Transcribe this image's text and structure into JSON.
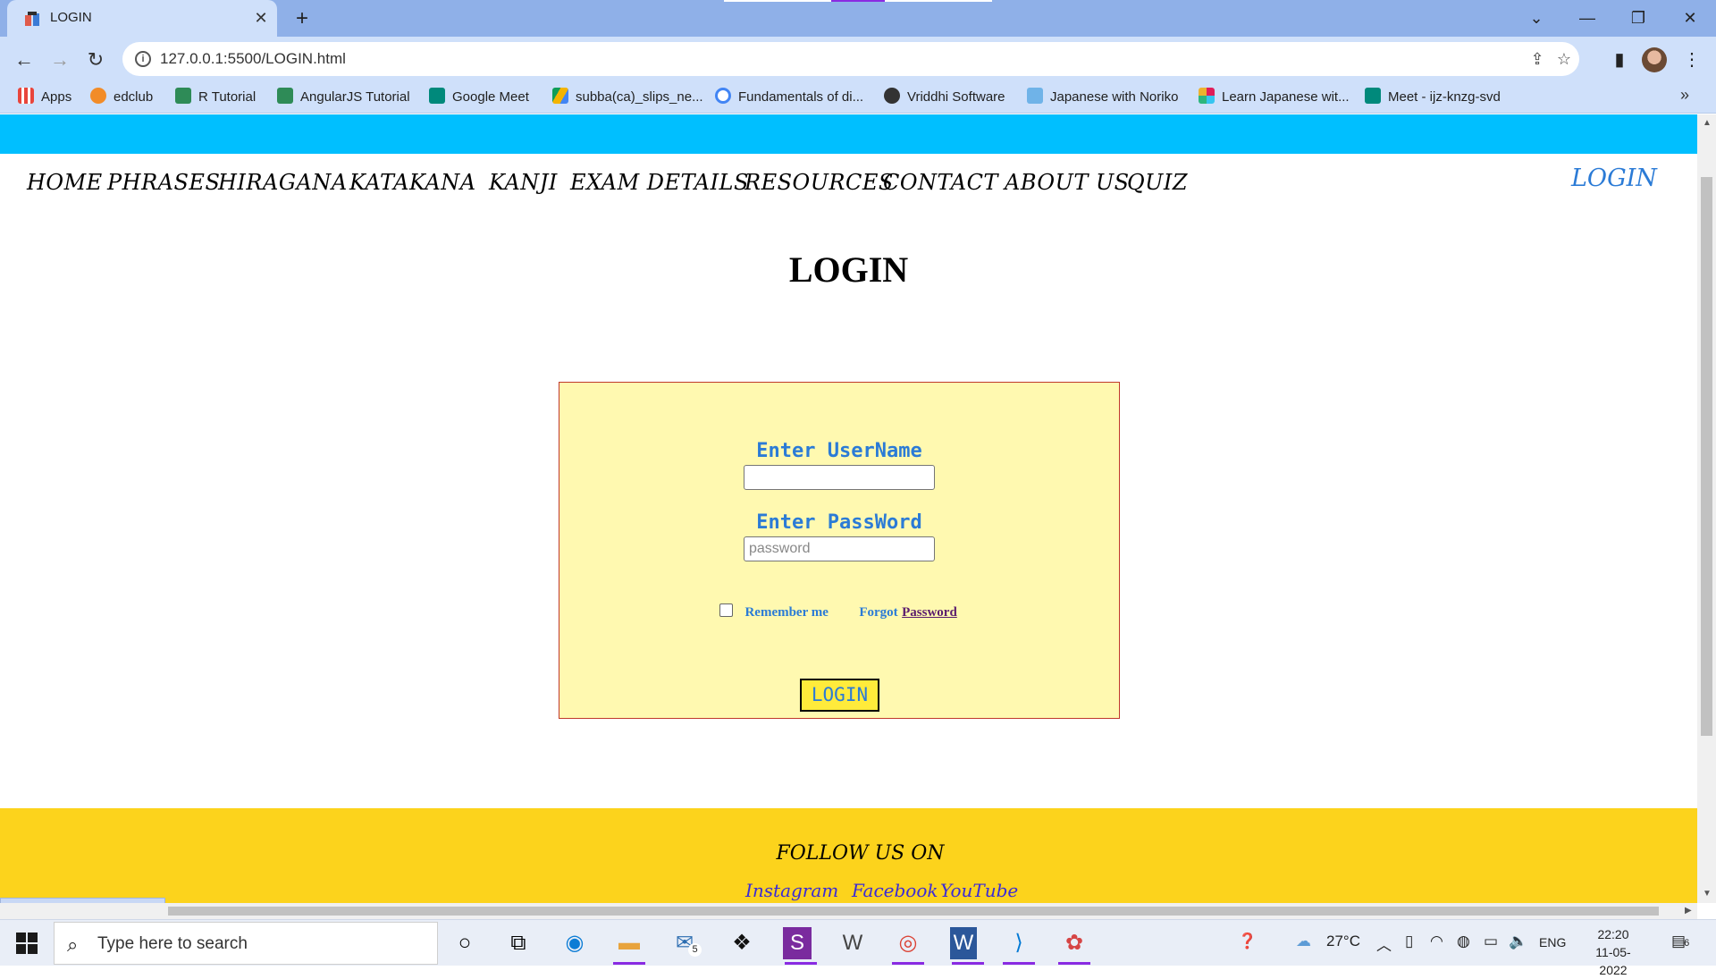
{
  "browser": {
    "tab_title": "LOGIN",
    "new_tab_symbol": "+",
    "close_symbol": "✕",
    "url": "127.0.0.1:5500/LOGIN.html",
    "window_controls": [
      "⌄",
      "—",
      "❐",
      "✕"
    ]
  },
  "bookmarks": [
    {
      "label": "Apps",
      "icon": "apps-grid-icon",
      "color": "#e8453c"
    },
    {
      "label": "edclub",
      "icon": "edclub-icon",
      "color": "#f28c28"
    },
    {
      "label": "R Tutorial",
      "icon": "w3schools-icon",
      "color": "#2e8b57"
    },
    {
      "label": "AngularJS Tutorial",
      "icon": "w3schools-icon",
      "color": "#2e8b57"
    },
    {
      "label": "Google Meet",
      "icon": "google-meet-icon",
      "color": "#00897b"
    },
    {
      "label": "subba(ca)_slips_ne...",
      "icon": "google-drive-icon",
      "color": "#f4b400"
    },
    {
      "label": "Fundamentals of di...",
      "icon": "google-icon",
      "color": "#4285f4"
    },
    {
      "label": "Vriddhi Software",
      "icon": "globe-icon",
      "color": "#333333"
    },
    {
      "label": "Japanese with Noriko",
      "icon": "page-icon",
      "color": "#6fb3e8"
    },
    {
      "label": "Learn Japanese wit...",
      "icon": "slack-like-icon",
      "color": "#e01e5a"
    },
    {
      "label": "Meet - ijz-knzg-svd",
      "icon": "google-meet-icon",
      "color": "#00897b"
    }
  ],
  "site": {
    "nav": [
      "HOME",
      "PHRASES",
      "HIRAGANA",
      "KATAKANA",
      "KANJI",
      "EXAM DETAILS",
      "RESOURCES",
      "CONTACT",
      "ABOUT US",
      "QUIZ"
    ],
    "nav_login": "LOGIN",
    "page_title": "LOGIN",
    "form": {
      "username_label": "Enter UserName",
      "username_value": "",
      "password_label": "Enter PassWord",
      "password_placeholder": "password",
      "remember_label": "Remember me",
      "forgot_prefix": "Forgot",
      "forgot_link": "Password",
      "submit_label": "LOGIN"
    },
    "footer": {
      "follow": "FOLLOW US ON",
      "links": [
        "Instagram",
        "Facebook",
        "YouTube"
      ]
    }
  },
  "status_url": "127.0.0.1:5500/LOGIN.html",
  "taskbar": {
    "search_placeholder": "Type here to search",
    "mail_badge": "5",
    "weather": "27°C",
    "language": "ENG",
    "time": "22:20",
    "date": "11-05-2022",
    "notification_count": "6"
  },
  "colors": {
    "accent_blue": "#2b7bd6",
    "cyan_band": "#00bfff",
    "form_bg": "#fff9b0",
    "footer_bg": "#fcd31c",
    "button_bg": "#ffeb3b"
  }
}
